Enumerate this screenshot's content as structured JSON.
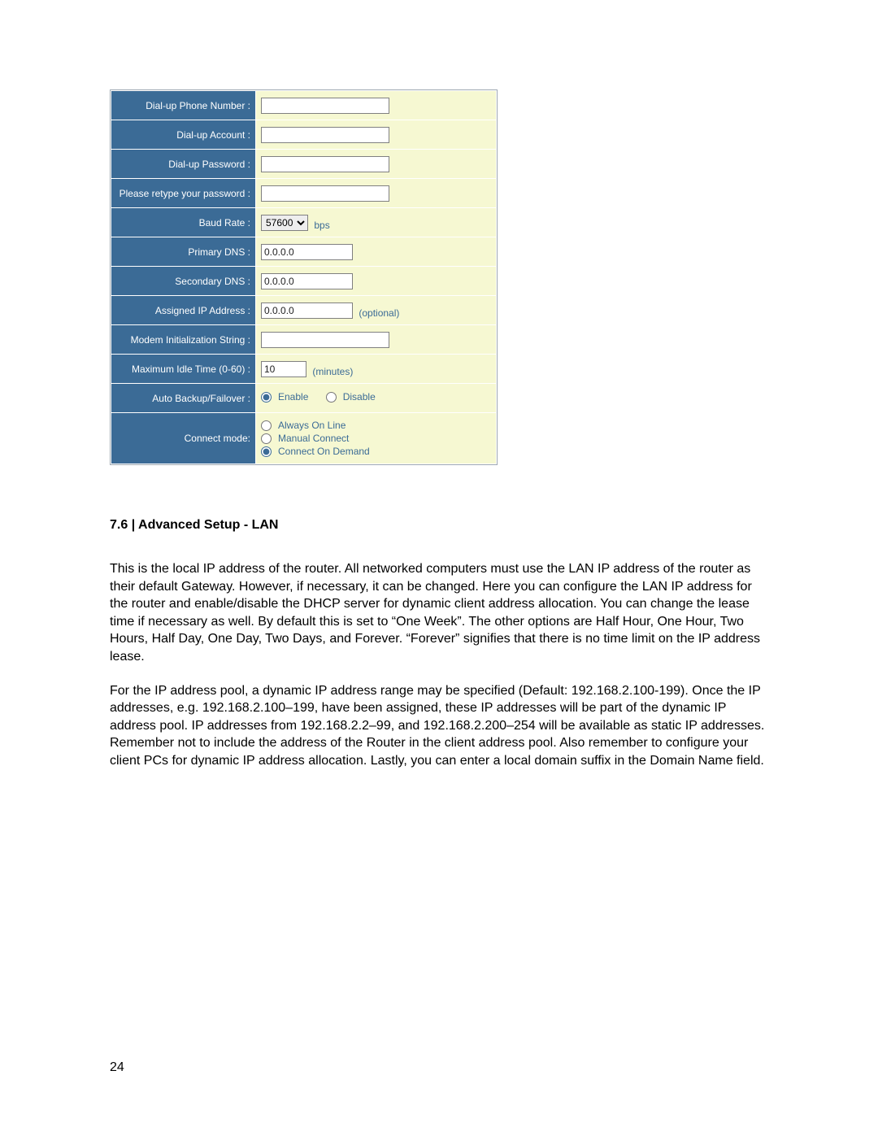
{
  "form": {
    "dialup_phone": {
      "label": "Dial-up Phone Number :",
      "value": ""
    },
    "dialup_account": {
      "label": "Dial-up Account :",
      "value": ""
    },
    "dialup_password": {
      "label": "Dial-up Password :",
      "value": ""
    },
    "retype_password": {
      "label": "Please retype your password :",
      "value": ""
    },
    "baud_rate": {
      "label": "Baud Rate :",
      "value": "57600",
      "unit": "bps"
    },
    "primary_dns": {
      "label": "Primary DNS :",
      "value": "0.0.0.0"
    },
    "secondary_dns": {
      "label": "Secondary DNS :",
      "value": "0.0.0.0"
    },
    "assigned_ip": {
      "label": "Assigned IP Address :",
      "value": "0.0.0.0",
      "note": "(optional)"
    },
    "modem_init": {
      "label": "Modem Initialization String :",
      "value": ""
    },
    "max_idle": {
      "label": "Maximum Idle Time (0-60) :",
      "value": "10",
      "unit": "(minutes)"
    },
    "auto_backup": {
      "label": "Auto Backup/Failover :",
      "enable": "Enable",
      "disable": "Disable"
    },
    "connect_mode": {
      "label": "Connect mode:",
      "opt1": "Always On Line",
      "opt2": "Manual Connect",
      "opt3": "Connect On Demand"
    }
  },
  "doc": {
    "heading": "7.6 | Advanced Setup - LAN",
    "para1": "This is the local IP address of the router. All networked computers must use the LAN IP address of the router as their default Gateway. However, if necessary, it can be changed. Here you can configure the LAN IP address for the router and enable/disable the DHCP server for dynamic client address allocation. You can change the lease time if necessary as well. By default this is set to “One Week”. The other options are Half Hour, One Hour, Two Hours, Half Day, One Day, Two Days, and Forever. “Forever” signifies that there is no time limit on the IP address lease.",
    "para2": "For the IP address pool, a dynamic IP address range may be specified (Default: 192.168.2.100-199). Once the IP addresses, e.g. 192.168.2.100–199, have been assigned, these IP addresses will be part of the dynamic IP address pool. IP addresses from 192.168.2.2–99, and 192.168.2.200–254 will be available as static IP addresses. Remember not to include the address of the Router in the client address pool. Also remember to configure your client PCs for dynamic IP address allocation. Lastly, you can enter a local domain suffix in the Domain Name field.",
    "page_number": "24"
  }
}
